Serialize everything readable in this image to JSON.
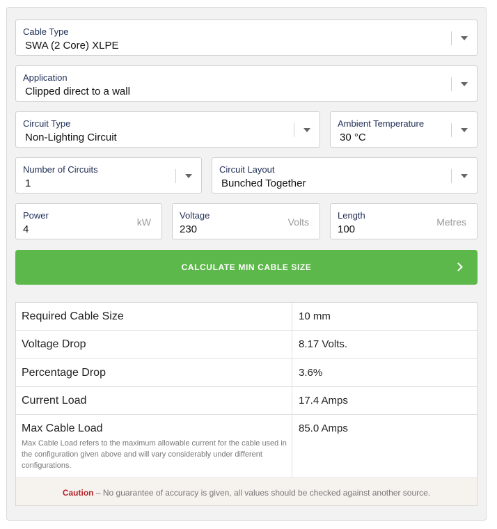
{
  "form": {
    "cable_type": {
      "label": "Cable Type",
      "value": "SWA (2 Core) XLPE"
    },
    "application": {
      "label": "Application",
      "value": "Clipped direct to a wall"
    },
    "circuit_type": {
      "label": "Circuit Type",
      "value": "Non-Lighting Circuit"
    },
    "ambient_temperature": {
      "label": "Ambient Temperature",
      "value": "30 °C"
    },
    "number_of_circuits": {
      "label": "Number of Circuits",
      "value": "1"
    },
    "circuit_layout": {
      "label": "Circuit Layout",
      "value": "Bunched Together"
    },
    "power": {
      "label": "Power",
      "value": "4",
      "unit": "kW"
    },
    "voltage": {
      "label": "Voltage",
      "value": "230",
      "unit": "Volts"
    },
    "length": {
      "label": "Length",
      "value": "100",
      "unit": "Metres"
    }
  },
  "calculate_button": {
    "label": "CALCULATE MIN CABLE SIZE"
  },
  "results": {
    "rows": [
      {
        "label": "Required Cable Size",
        "value": "10 mm"
      },
      {
        "label": "Voltage Drop",
        "value": "8.17 Volts."
      },
      {
        "label": "Percentage Drop",
        "value": "3.6%"
      },
      {
        "label": "Current Load",
        "value": "17.4 Amps"
      },
      {
        "label": "Max Cable Load",
        "value": "85.0 Amps",
        "note": "Max Cable Load refers to the maximum allowable current for the cable used in the configuration given above and will vary considerably under different configurations."
      }
    ],
    "caution": {
      "word": "Caution",
      "text": " – No guarantee of accuracy is given, all values should be checked against another source."
    }
  },
  "colors": {
    "accent_green": "#5cb84a",
    "caution_red": "#b5252b",
    "label_navy": "#1f2d55"
  },
  "icons": {
    "dropdown": "caret-down-icon",
    "button": "chevron-right-icon"
  }
}
